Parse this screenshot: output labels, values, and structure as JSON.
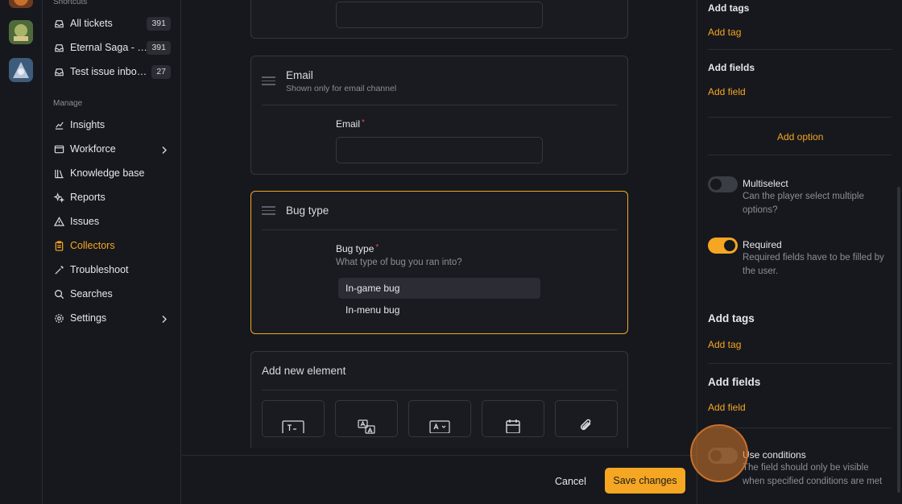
{
  "sidebar": {
    "shortcuts_label": "Shortcuts",
    "shortcuts": [
      {
        "label": "All tickets",
        "count": "391"
      },
      {
        "label": "Eternal Saga - Player Support",
        "count": "391"
      },
      {
        "label": "Test issue inbox demo",
        "count": "27"
      }
    ],
    "manage_label": "Manage",
    "items": [
      {
        "label": "Insights"
      },
      {
        "label": "Workforce"
      },
      {
        "label": "Knowledge base"
      },
      {
        "label": "Reports"
      },
      {
        "label": "Issues"
      },
      {
        "label": "Collectors"
      },
      {
        "label": "Troubleshoot"
      },
      {
        "label": "Searches"
      },
      {
        "label": "Settings"
      }
    ]
  },
  "form": {
    "email_card": {
      "title": "Email",
      "subtitle": "Shown only for email channel",
      "field_label": "Email",
      "required_mark": "*"
    },
    "bug_card": {
      "title": "Bug type",
      "field_label": "Bug type",
      "required_mark": "*",
      "help": "What type of bug you ran into?",
      "options": [
        "In-game bug",
        "In-menu bug"
      ]
    },
    "add_element": {
      "title": "Add new element"
    }
  },
  "footer": {
    "cancel": "Cancel",
    "save": "Save changes"
  },
  "panel": {
    "add_tags_1": "Add tags",
    "add_tag_1": "Add tag",
    "add_fields_1": "Add fields",
    "add_field_1": "Add field",
    "add_option": "Add option",
    "multiselect": {
      "title": "Multiselect",
      "desc": "Can the player select multiple options?",
      "on": false
    },
    "required": {
      "title": "Required",
      "desc": "Required fields have to be filled by the user.",
      "on": true
    },
    "add_tags_2": "Add tags",
    "add_tag_2": "Add tag",
    "add_fields_2": "Add fields",
    "add_field_2": "Add field",
    "use_conditions": {
      "title": "Use conditions",
      "desc": "The field should only be visible when specified conditions are met",
      "on": false
    }
  },
  "colors": {
    "accent": "#f5a623",
    "background": "#16181d",
    "required": "#e5484d"
  }
}
